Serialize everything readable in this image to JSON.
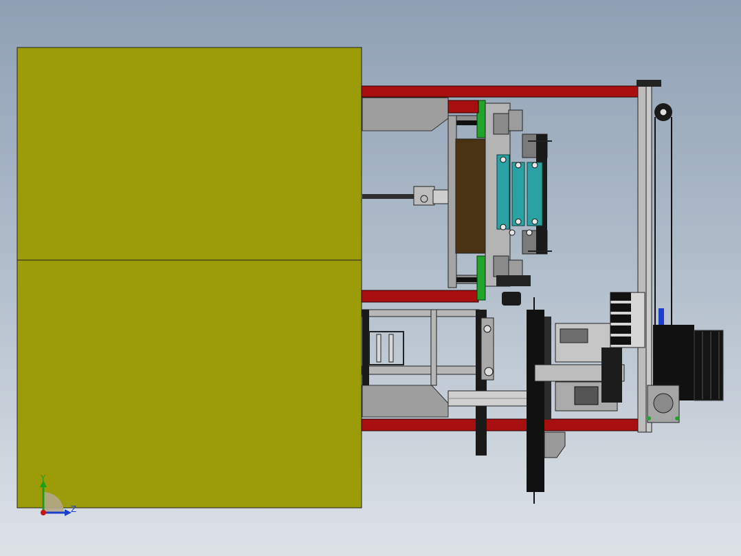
{
  "viewport": {
    "background_top": "#8fa0b4",
    "background_bottom": "#dde2e7"
  },
  "colors": {
    "panel": "#9b9c08",
    "frame_red": "#a80f0f",
    "plate_brown": "#4a3312",
    "rail_teal": "#2aa1a3",
    "guide_green": "#1fa62a",
    "steel_gray": "#9b9b9b",
    "motor_dark": "#111111"
  },
  "triad": {
    "y_label": "Y",
    "z_label": "Z",
    "y_color": "#1aa11a",
    "z_color": "#1a3fd0",
    "x_color": "#c81414"
  }
}
